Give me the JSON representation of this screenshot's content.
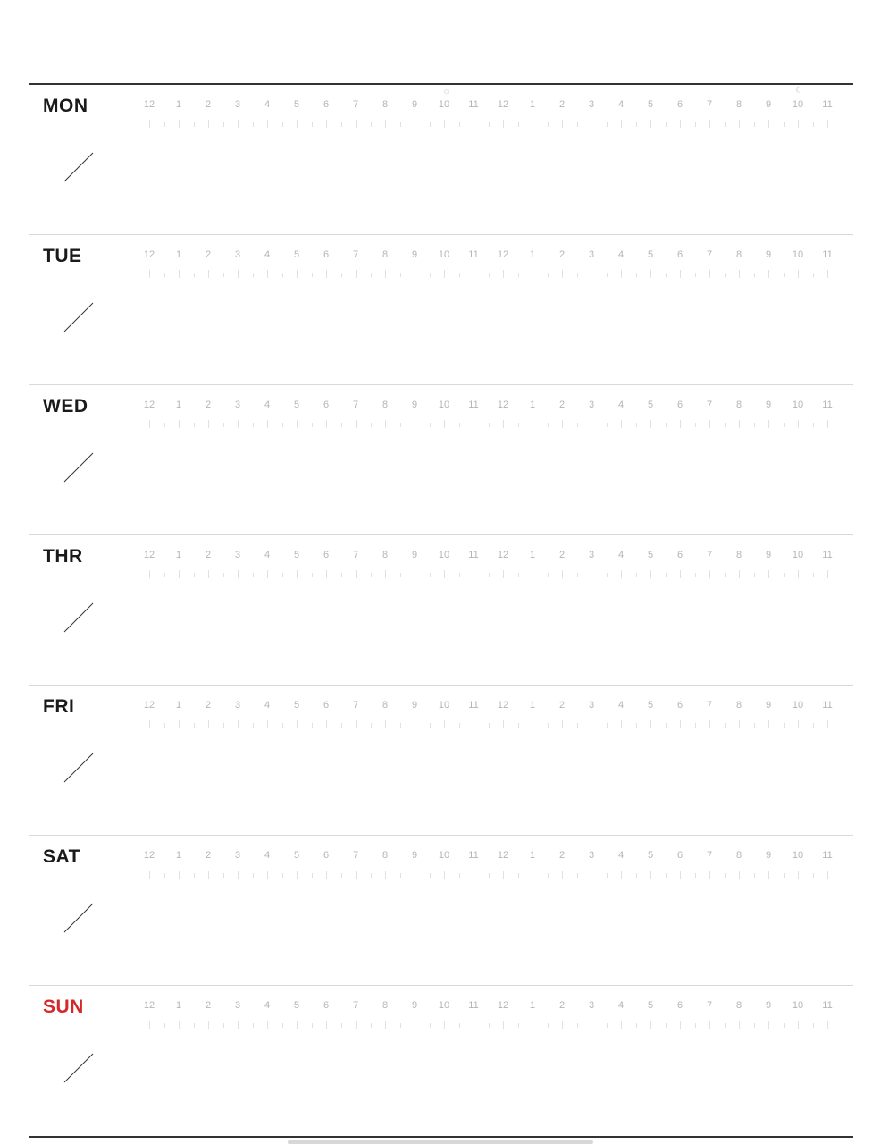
{
  "days": [
    {
      "label": "MON"
    },
    {
      "label": "TUE"
    },
    {
      "label": "WED"
    },
    {
      "label": "THR"
    },
    {
      "label": "FRI"
    },
    {
      "label": "SAT"
    },
    {
      "label": "SUN"
    }
  ],
  "hours": [
    "12",
    "1",
    "2",
    "3",
    "4",
    "5",
    "6",
    "7",
    "8",
    "9",
    "10",
    "11",
    "12",
    "1",
    "2",
    "3",
    "4",
    "5",
    "6",
    "7",
    "8",
    "9",
    "10",
    "11"
  ],
  "icons": {
    "daytime": "sun-icon",
    "nighttime": "moon-icon"
  },
  "colors": {
    "text": "#1a1a1a",
    "sunday": "#d62828",
    "hour_labels": "#b5b5b5",
    "rule": "#333333"
  }
}
